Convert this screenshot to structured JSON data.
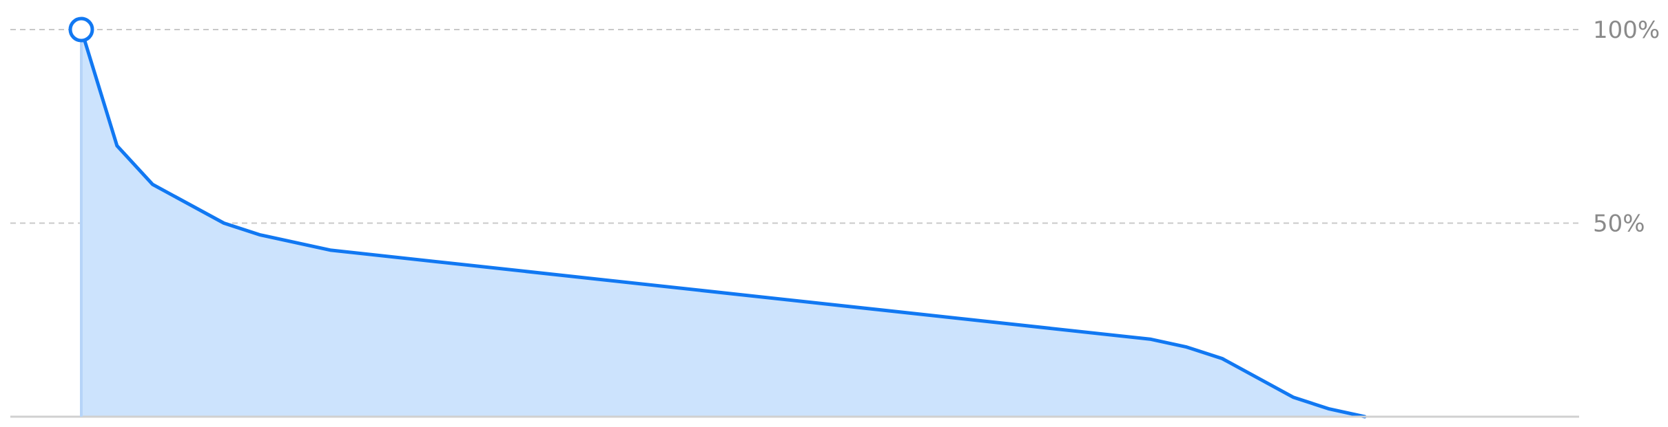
{
  "chart_data": {
    "type": "area",
    "title": "",
    "xlabel": "",
    "ylabel": "",
    "y_unit": "%",
    "ylim": [
      0,
      100
    ],
    "x_range": [
      0,
      100
    ],
    "grid": true,
    "y_axis_position": "right",
    "y_ticks": [
      {
        "value": 50,
        "label": "50%"
      },
      {
        "value": 100,
        "label": "100%"
      }
    ],
    "highlighted_point_index": 0,
    "series": [
      {
        "x": [
          0,
          2.5,
          5,
          10,
          12.5,
          17.5,
          75,
          77.5,
          80,
          85,
          87.5,
          90
        ],
        "y": [
          100,
          70,
          60,
          50,
          47,
          43,
          20,
          18,
          15,
          5,
          2,
          0
        ]
      }
    ],
    "colors": {
      "line": "#1178f2",
      "fill": "#cce3fd",
      "cursor": "#b6d4f8",
      "grid": "#c8c8c8",
      "axis": "#d0d0d0",
      "tick_text": "#8a8a8a"
    }
  }
}
